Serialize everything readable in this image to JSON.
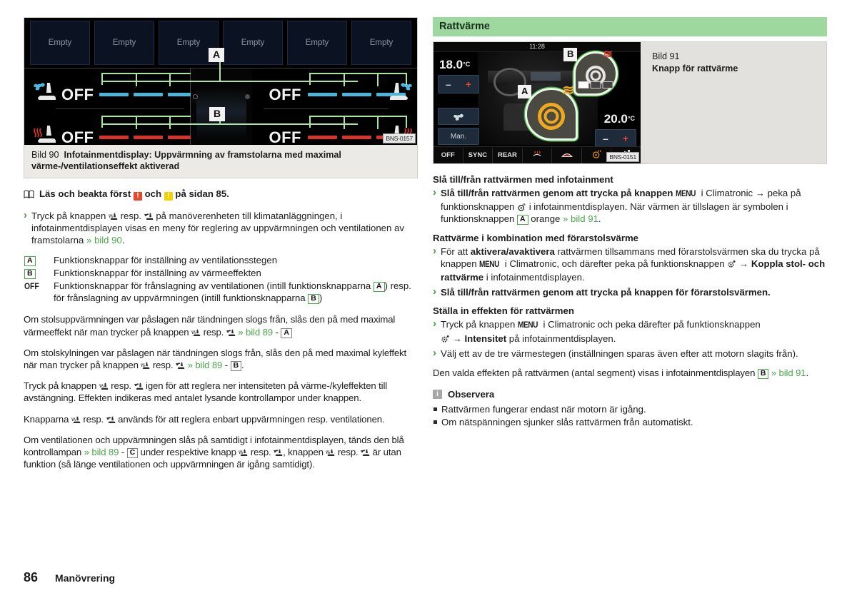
{
  "footer": {
    "page_number": "86",
    "section": "Manövrering"
  },
  "left": {
    "figure90": {
      "display": {
        "tiles": [
          "Empty",
          "Empty",
          "Empty",
          "Empty",
          "Empty",
          "Empty"
        ],
        "left_seat": {
          "vent_value": "OFF",
          "heat_value": "OFF"
        },
        "right_seat": {
          "vent_value": "OFF",
          "heat_value": "OFF"
        },
        "callout_a": "A",
        "callout_b": "B",
        "image_code": "BNS-0157"
      },
      "caption_number": "Bild 90",
      "caption_text": "Infotainmentdisplay: Uppvärmning av framstolarna med maximal värme-/ventilationseffekt aktiverad"
    },
    "read_first": {
      "before": "Läs och beakta först",
      "middle": "och",
      "after": "på sidan 85."
    },
    "intro_bullet": {
      "part1": "Tryck på knappen ",
      "icon1": "seat-heat-icon",
      "part2": " resp. ",
      "icon2": "seat-vent-icon",
      "part3": " på manöverenheten till klimatanläggningen, i infotainmentdisplayen visas en meny för reglering av uppvärmningen och ventilationen av framstolarna ",
      "ref": "» bild 90",
      "end": "."
    },
    "legend": [
      {
        "key": "A",
        "key_type": "box",
        "text": "Funktionsknappar för inställning av ventilationsstegen"
      },
      {
        "key": "B",
        "key_type": "box",
        "text": "Funktionsknappar för inställning av värmeeffekten"
      },
      {
        "key": "OFF",
        "key_type": "text",
        "text_pre": "Funktionsknappar för frånslagning av ventilationen (intill funktionsknapparna ",
        "tag1": "A",
        "text_mid": ") resp. för frånslagning av uppvärmningen (intill funktionsknapparna ",
        "tag2": "B",
        "text_post": ")"
      }
    ],
    "paragraphs": [
      {
        "pre": "Om stolsuppvärmningen var påslagen när tändningen slogs från, slås den på med maximal värmeeffekt när man trycker på knappen ",
        "icon1": "seat-heat-icon",
        "mid": " resp. ",
        "icon2": "seat-vent-icon",
        "ref": "» bild 89",
        "dash": " - ",
        "tag": "A",
        "post": ""
      },
      {
        "pre": "Om stolskylningen var påslagen när tändningen slogs från, slås den på med maximal kyleffekt när man trycker på knappen ",
        "icon1": "seat-heat-icon",
        "mid": " resp. ",
        "icon2": "seat-vent-icon",
        "ref": "» bild 89",
        "dash": " - ",
        "tag": "B",
        "post": "."
      }
    ],
    "para3": {
      "pre": "Tryck på knappen ",
      "icon1": "seat-heat-icon",
      "mid": " resp. ",
      "icon2": "seat-vent-icon",
      "post": " igen för att reglera ner intensiteten på värme-/kyleffekten till avstängning. Effekten indikeras med antalet lysande kontrollampor under knappen."
    },
    "para4": {
      "pre": "Knapparna ",
      "icon1": "seat-heat-icon",
      "mid": " resp. ",
      "icon2": "seat-vent-icon",
      "post": " används för att reglera enbart uppvärmningen resp. ventilationen."
    },
    "para5": {
      "pre": "Om ventilationen och uppvärmningen slås på samtidigt i infotainmentdisplayen, tänds den blå kontrollampan ",
      "ref": "» bild 89",
      "dash": " - ",
      "tag": "C",
      "mid": " under respektive knapp ",
      "icon1": "seat-heat-icon",
      "mid2": " resp. ",
      "icon2": "seat-vent-icon",
      "mid3": ", knappen ",
      "icon3": "seat-heat-icon",
      "mid4": " resp. ",
      "icon4": "seat-vent-icon",
      "post": " är utan funktion (så länge ventilationen och uppvärmningen är igång samtidigt)."
    }
  },
  "right": {
    "section_title": "Rattvärme",
    "figure91": {
      "display": {
        "clock": "11:28",
        "temp_left": "18.0",
        "temp_right": "20.0",
        "temp_unit": "°C",
        "auto_button": "Man.",
        "fan_icon": "fan-icon",
        "minus": "–",
        "plus": "+",
        "bottom_bar": [
          "OFF",
          "SYNC",
          "REAR",
          "rear-defrost-icon",
          "windshield-defrost-icon",
          "steering-heat-icon",
          "settings-icon"
        ],
        "callout_a": "A",
        "callout_b": "B",
        "segments_on": 1,
        "segments_total": 3,
        "image_code": "BNS-0151"
      },
      "caption_number": "Bild 91",
      "caption_text": "Knapp för rattvärme"
    },
    "blocks": [
      {
        "heading": "Slå till/från rattvärmen med infotainment",
        "items": [
          {
            "b1": "Slå till/från",
            "t1": " rattvärmen genom att trycka på knappen ",
            "key": "MENU",
            "t2": " i Climatronic → peka på funktionsknappen ",
            "icon": "steering-heat-icon",
            "t3": " i infotainmentdisplayen. När värmen är tillslagen är symbolen i funktionsknappen ",
            "tag": "A",
            "t4": " orange ",
            "ref": "» bild 91",
            "t5": "."
          }
        ]
      },
      {
        "heading": "Rattvärme i kombination med förarstolsvärme",
        "items": [
          {
            "t0": "För att ",
            "b1": "aktivera/avaktivera",
            "t1": " rattvärmen tillsammans med förarstolsvärmen ska du trycka på knappen ",
            "key": "MENU",
            "t2": " i Climatronic, och därefter peka på funktionsknappen ",
            "icon": "settings-icon",
            "t3": " → ",
            "b2": "Koppla stol- och rattvärme",
            "t4": " i infotainmentdisplayen."
          },
          {
            "b1": "Slå till/från",
            "t1": " rattvärmen genom att trycka på knappen för förarstolsvärmen."
          }
        ]
      },
      {
        "heading": "Ställa in effekten för rattvärmen",
        "items": [
          {
            "t0": "Tryck på knappen ",
            "key": "MENU",
            "t1": " i Climatronic och peka därefter på funktionsknappen ",
            "icon": "settings-icon",
            "t2": " → ",
            "b1": "Intensitet",
            "t3": " på infotainmentdisplayen."
          },
          {
            "t0": "Välj ett av de tre värmestegen (inställningen sparas även efter att motorn slagits från)."
          }
        ]
      }
    ],
    "closing": {
      "pre": "Den valda effekten på rattvärmen (antal segment) visas i infotainmentdisplayen ",
      "tag": "B",
      "ref": " » bild 91",
      "post": "."
    },
    "note": {
      "title": "Observera",
      "items": [
        "Rattvärmen fungerar endast när motorn är igång.",
        "Om nätspänningen sjunker slås rattvärmen från automatiskt."
      ]
    }
  },
  "colors": {
    "accent_green": "#9ed89e",
    "ref_green": "#4aa84a",
    "caption_bg": "#eceae6",
    "warning_red": "#e8452a",
    "warning_yellow": "#f2d200",
    "orange_icon": "#f0a81e"
  }
}
